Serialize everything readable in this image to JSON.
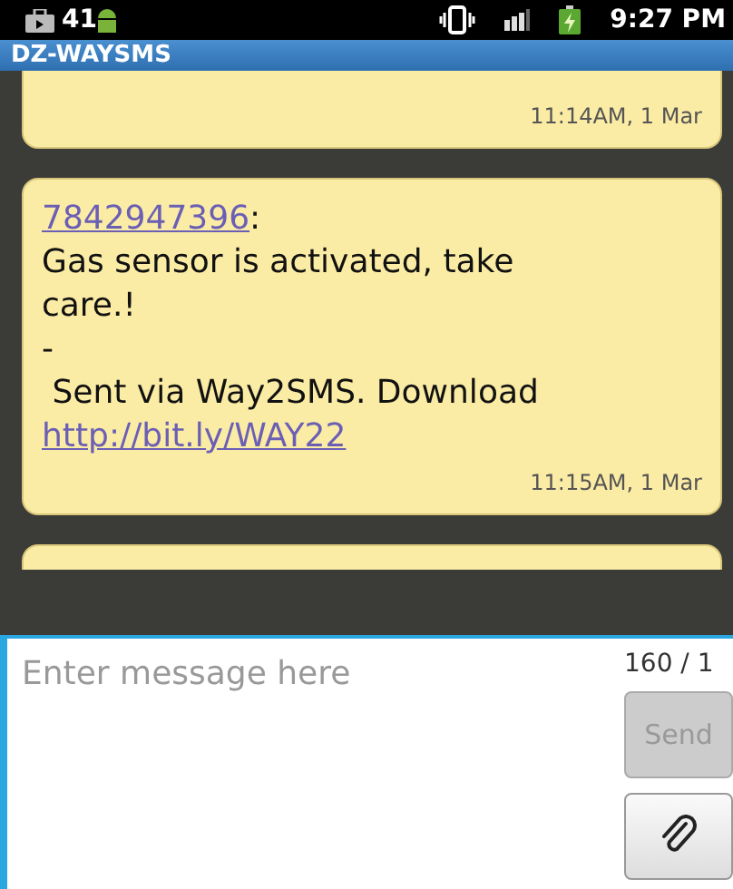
{
  "status_bar": {
    "notification_text": "41",
    "time": "9:27 PM"
  },
  "window": {
    "title": "DZ-WAYSMS"
  },
  "messages": [
    {
      "partial": true,
      "time": "11:14AM, 1 Mar"
    },
    {
      "partial": false,
      "sender": "7842947396",
      "separator": ":",
      "body": [
        "Gas sensor is activated, take care.!",
        "-",
        " Sent via Way2SMS. Download"
      ],
      "link": "http://bit.ly/WAY22",
      "time": "11:15AM, 1 Mar"
    }
  ],
  "composer": {
    "placeholder": "Enter message here",
    "counter": "160 / 1",
    "send_button": {
      "label": "Send",
      "disabled": true
    }
  }
}
